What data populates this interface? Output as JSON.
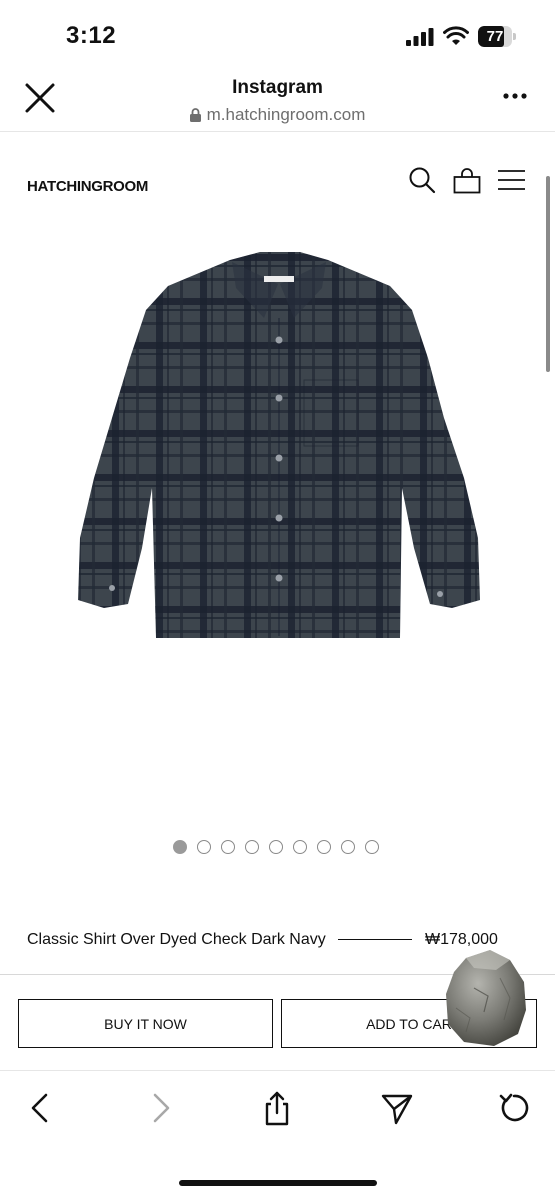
{
  "status_bar": {
    "time": "3:12",
    "battery_percent": "77",
    "battery_level": 0.77
  },
  "browser_header": {
    "title": "Instagram",
    "url": "m.hatchingroom.com",
    "close_icon": "close-icon",
    "more_icon": "more-icon"
  },
  "site_nav": {
    "logo": "HATCHINGROOM",
    "icons": [
      "search-icon",
      "shopping-bag-icon",
      "menu-icon"
    ]
  },
  "carousel": {
    "total": 9,
    "active_index": 0
  },
  "product": {
    "name": "Classic Shirt Over Dyed Check Dark Navy",
    "price": "₩178,000"
  },
  "actions": {
    "buy_label": "BUY IT NOW",
    "cart_label": "ADD TO CAR"
  },
  "toolbar": {
    "icons": [
      "back-icon",
      "forward-icon",
      "share-icon",
      "send-icon",
      "reload-icon"
    ]
  },
  "colors": {
    "shirt_base": "#414a52",
    "shirt_check": "#1c2433",
    "accent": "#111111"
  }
}
